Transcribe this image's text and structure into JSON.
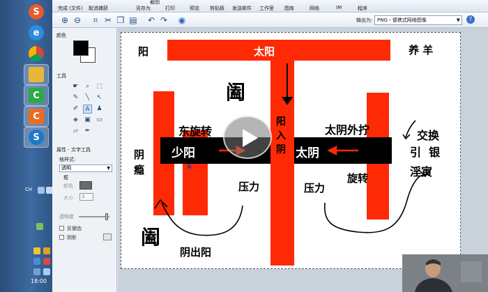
{
  "ribbon": {
    "items": [
      {
        "label": "完成 (文件)",
        "icon_color": "#3366aa"
      },
      {
        "label": "取消捕获",
        "icon_color": "#3366aa"
      },
      {
        "label": "另存为",
        "icon_color": "#4477bb"
      },
      {
        "label": "打印",
        "icon_color": "#4477bb"
      },
      {
        "label": "预览",
        "icon_color": "#4477bb"
      },
      {
        "label": "剪贴板",
        "icon_color": "#4477bb"
      },
      {
        "label": "发送邮件",
        "icon_color": "#4477bb"
      },
      {
        "label": "工作室",
        "icon_color": "#4477bb"
      },
      {
        "label": "图库",
        "icon_color": "#4477bb"
      },
      {
        "label": "网络",
        "icon_color": "#4477bb"
      },
      {
        "label": "IM",
        "icon_color": "#4477bb"
      },
      {
        "label": "程序",
        "icon_color": "#4477bb"
      }
    ],
    "top_label": "截图"
  },
  "toolbar": {
    "output_label": "输出为:",
    "output_value": "PNG - 便携式网络图像",
    "tools": [
      "zoom-in-icon",
      "zoom-out-icon",
      "crop-icon",
      "cut-icon",
      "copy-icon",
      "paste-icon",
      "undo-icon",
      "redo-icon",
      "help-icon"
    ]
  },
  "panel": {
    "color_title": "颜色",
    "tools_title": "工具",
    "props_title": "属性 - 文字工具",
    "font_label": "格样式:",
    "font_value": "透明",
    "border_label": "框",
    "color_label": "颜色",
    "size_label": "大小",
    "size_value": "3",
    "opacity_label": "透明度",
    "outline_label": "反锯齿",
    "shadow_label": "阴影"
  },
  "canvas": {
    "texts": {
      "yang": "阳",
      "taiyang": "太阳",
      "yangyang": "养 羊",
      "kui_top": "阖",
      "dong_xuan_zhuan": "东旋转",
      "yang_ru_yin": "阳\n入\n阴",
      "taiyin_wai_bo": "太阴外拧",
      "jiao_huan": "交换",
      "yin_yin": "引  银",
      "yin_pi": "阴\n瘾",
      "shaoyang": "少阳",
      "taiyin": "太阴",
      "yin_yin2": "淫寅",
      "xuan_zhuan": "旋转",
      "yali_left": "压力",
      "yali_right": "压力",
      "kui_bottom": "阖",
      "yin_chu_yang": "阴出阳",
      "cursor_A": "A"
    }
  },
  "taskbar": {
    "clock": "18:00",
    "lang": "CH"
  }
}
